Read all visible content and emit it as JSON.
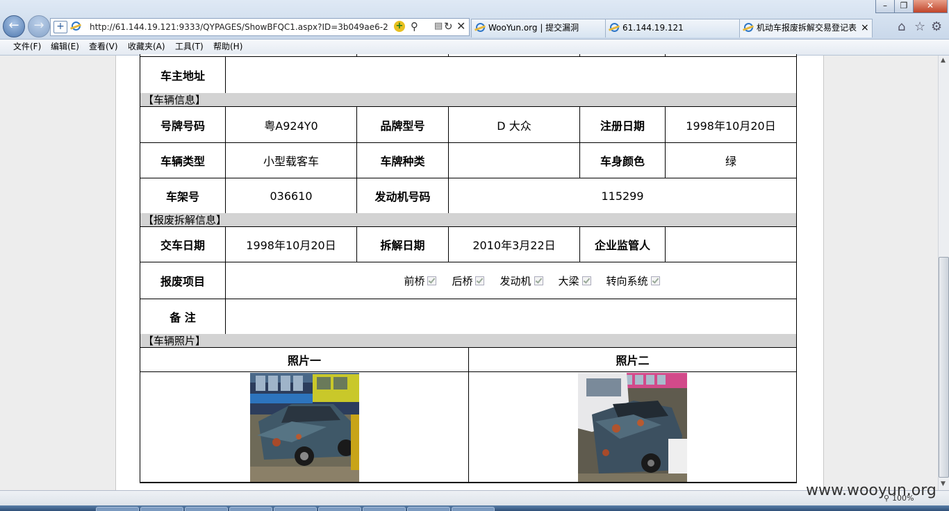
{
  "browser": {
    "url": "http://61.144.19.121:9333/QYPAGES/ShowBFQC1.aspx?ID=3b049ae6-25a7-",
    "tabs": [
      {
        "label": "WooYun.org | 提交漏洞"
      },
      {
        "label": "61.144.19.121"
      },
      {
        "label": "机动车报废拆解交易登记表"
      }
    ],
    "tab_close": "×",
    "menu": [
      "文件(F)",
      "编辑(E)",
      "查看(V)",
      "收藏夹(A)",
      "工具(T)",
      "帮助(H)"
    ],
    "zoom": "100%"
  },
  "owner": {
    "address_label": "车主地址",
    "address_value": ""
  },
  "vehicle_section": {
    "title": "【车辆信息】",
    "plate_label": "号牌号码",
    "plate": "粤A924Y0",
    "brand_label": "品牌型号",
    "brand": "D 大众",
    "reg_label": "注册日期",
    "reg_date": "1998年10月20日",
    "type_label": "车辆类型",
    "type": "小型载客车",
    "plate_kind_label": "车牌种类",
    "plate_kind": "",
    "color_label": "车身颜色",
    "color": "绿",
    "frame_label": "车架号",
    "frame": "036610",
    "engine_label": "发动机号码",
    "engine": "115299"
  },
  "scrap_section": {
    "title": "【报废拆解信息】",
    "handover_label": "交车日期",
    "handover_date": "1998年10月20日",
    "dismantle_label": "拆解日期",
    "dismantle_date": "2010年3月22日",
    "supervisor_label": "企业监管人",
    "supervisor": "",
    "items_label": "报废项目",
    "items": [
      "前桥",
      "后桥",
      "发动机",
      "大梁",
      "转向系统"
    ],
    "remark_label": "备 注",
    "remark": ""
  },
  "photo_section": {
    "title": "【车辆照片】",
    "photo1_label": "照片一",
    "photo2_label": "照片二"
  },
  "watermark": "www.wooyun.org"
}
